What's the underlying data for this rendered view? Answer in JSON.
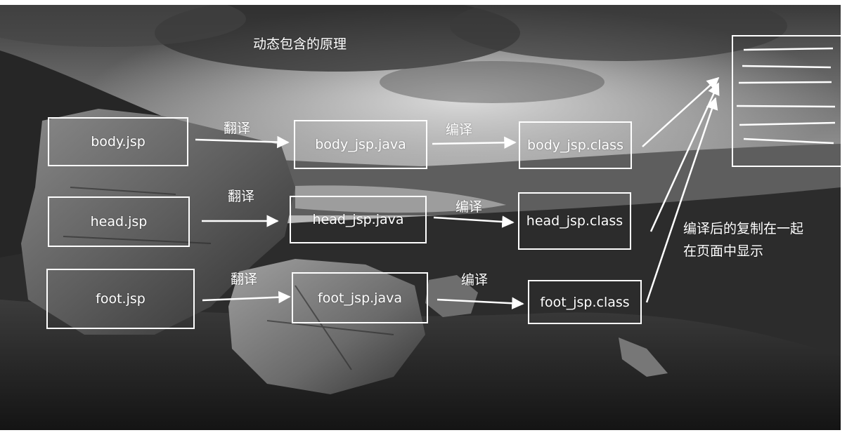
{
  "title": "动态包含的原理",
  "rows": [
    {
      "jsp": "body.jsp",
      "translate_label": "翻译",
      "java": "body_jsp.java",
      "compile_label": "编译",
      "class": "body_jsp.class"
    },
    {
      "jsp": "head.jsp",
      "translate_label": "翻译",
      "java": "head_jsp.java",
      "compile_label": "编译",
      "class": "head_jsp.class"
    },
    {
      "jsp": "foot.jsp",
      "translate_label": "翻译",
      "java": "foot_jsp.java",
      "compile_label": "编译",
      "class": "foot_jsp.class"
    }
  ],
  "note": {
    "line1": "编译后的复制在一起",
    "line2": "在页面中显示"
  },
  "colors": {
    "stroke": "#ffffff",
    "text": "#ffffff"
  },
  "background": "grayscale-mountain-lake-landscape"
}
